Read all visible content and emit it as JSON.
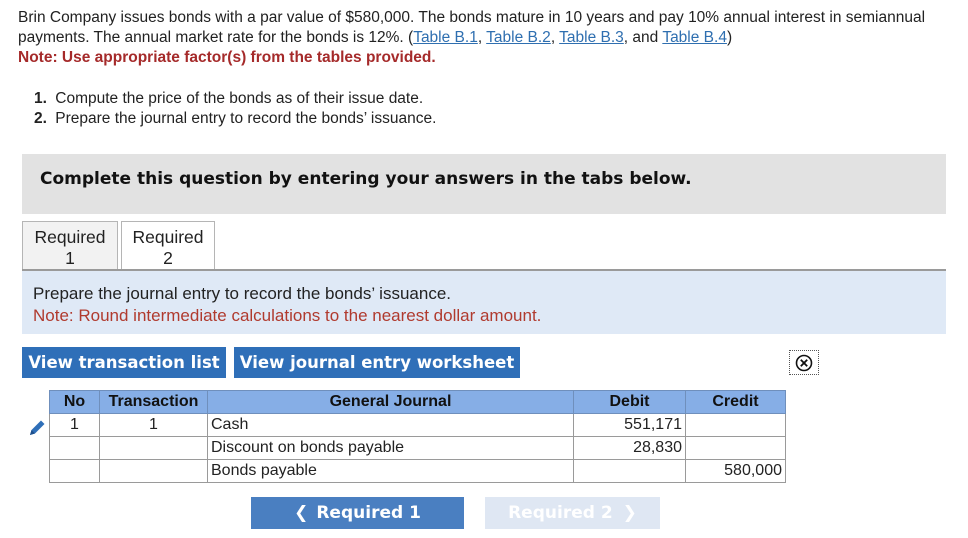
{
  "intro": {
    "text_a": "Brin Company issues bonds with a par value of $580,000. The bonds mature in 10 years and pay 10% annual interest in semiannual payments. The annual market rate for the bonds is 12%. (",
    "links": [
      "Table B.1",
      "Table B.2",
      "Table B.3",
      "Table B.4"
    ],
    "sep1": ", ",
    "sep2": ", ",
    "sep3": ", and ",
    "text_end": ")",
    "note": "Note: Use appropriate factor(s) from the tables provided."
  },
  "steps": [
    {
      "num": "1.",
      "text": "Compute the price of the bonds as of their issue date."
    },
    {
      "num": "2.",
      "text": "Prepare the journal entry to record the bonds’ issuance."
    }
  ],
  "banner": "Complete this question by entering your answers in the tabs below.",
  "tabs": [
    {
      "line1": "Required",
      "line2": "1"
    },
    {
      "line1": "Required",
      "line2": "2"
    }
  ],
  "instruction": {
    "text": "Prepare the journal entry to record the bonds’ issuance.",
    "note": "Note: Round intermediate calculations to the nearest dollar amount."
  },
  "buttons": {
    "view_transactions": "View transaction list",
    "view_worksheet": "View journal entry worksheet"
  },
  "journal": {
    "headers": [
      "No",
      "Transaction",
      "General Journal",
      "Debit",
      "Credit"
    ],
    "rows": [
      {
        "no": "1",
        "transaction": "1",
        "account": "Cash",
        "debit": "551,171",
        "credit": ""
      },
      {
        "no": "",
        "transaction": "",
        "account": "Discount on bonds payable",
        "debit": "28,830",
        "credit": ""
      },
      {
        "no": "",
        "transaction": "",
        "account": "Bonds payable",
        "debit": "",
        "credit": "580,000"
      }
    ]
  },
  "nav": {
    "prev": "Required 1",
    "next": "Required 2"
  },
  "colors": {
    "accent_blue": "#2f6fb8",
    "header_blue": "#86aee6",
    "note_red": "#a52a2a"
  }
}
